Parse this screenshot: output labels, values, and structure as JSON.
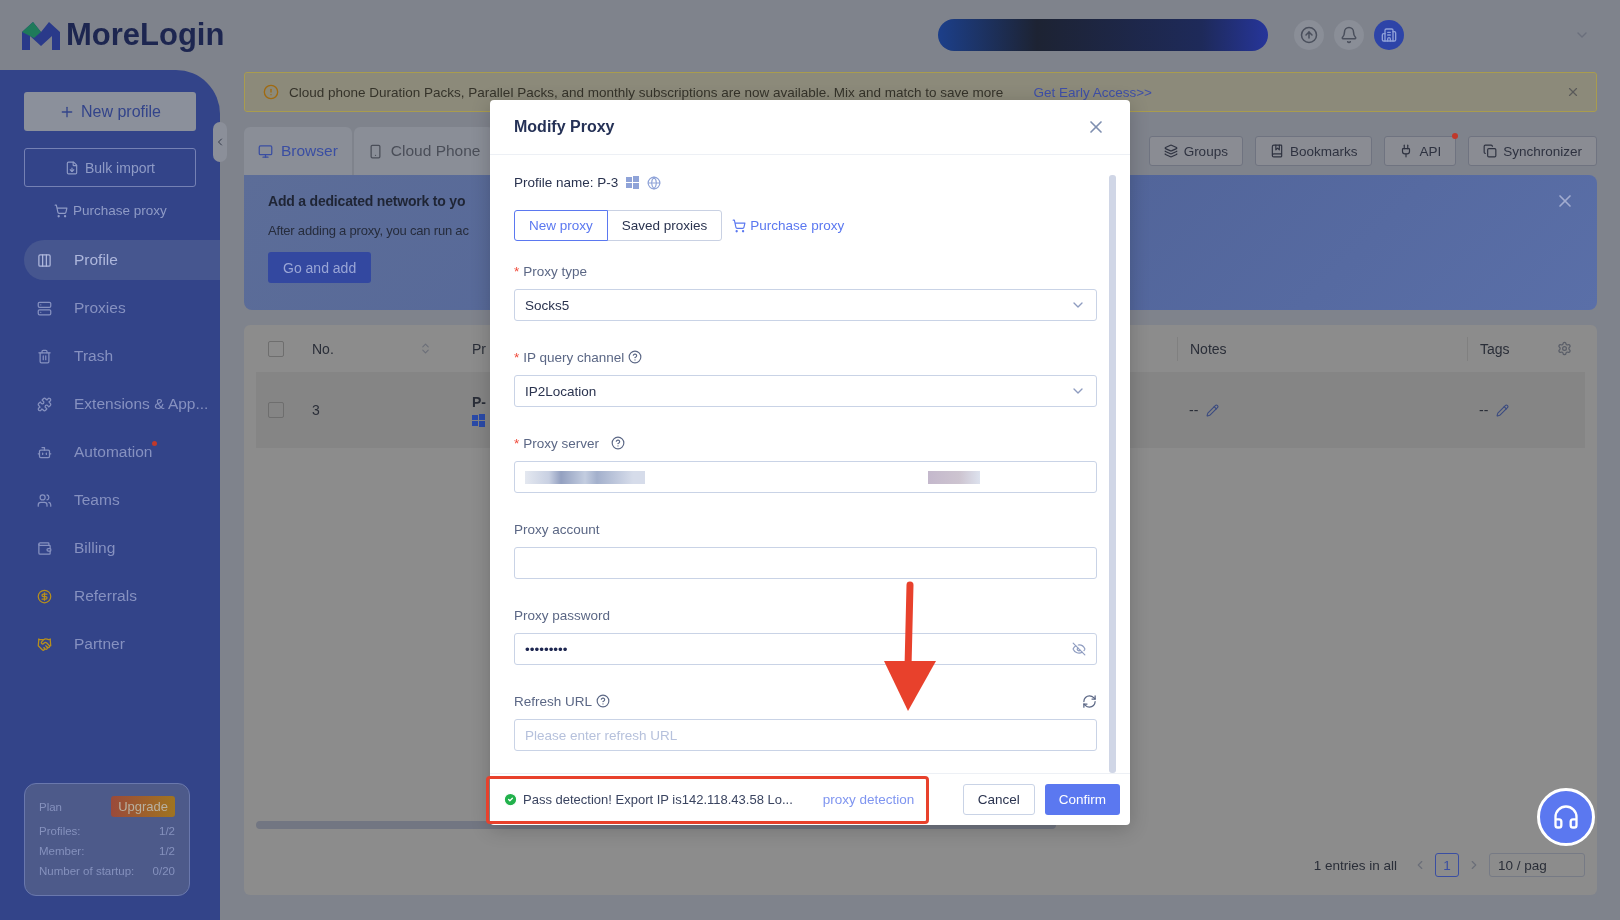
{
  "app": {
    "logo": "MoreLogin"
  },
  "sidebar": {
    "new_profile": "New profile",
    "bulk_import": "Bulk import",
    "purchase_proxy": "Purchase proxy",
    "nav": [
      {
        "label": "Profile",
        "selected": true,
        "dot": false
      },
      {
        "label": "Proxies",
        "selected": false,
        "dot": false
      },
      {
        "label": "Trash",
        "selected": false,
        "dot": false
      },
      {
        "label": "Extensions & App...",
        "selected": false,
        "dot": false
      },
      {
        "label": "Automation",
        "selected": false,
        "dot": true
      },
      {
        "label": "Teams",
        "selected": false,
        "dot": false
      },
      {
        "label": "Billing",
        "selected": false,
        "dot": false
      },
      {
        "label": "Referrals",
        "selected": false,
        "dot": false
      },
      {
        "label": "Partner",
        "selected": false,
        "dot": false
      }
    ],
    "plan": {
      "label": "Plan",
      "upgrade": "Upgrade",
      "stats": [
        {
          "label": "Profiles:",
          "value": "1/2"
        },
        {
          "label": "Member:",
          "value": "1/2"
        },
        {
          "label": "Number of startup:",
          "value": "0/20"
        }
      ]
    }
  },
  "notice": {
    "text": "Cloud phone Duration Packs, Parallel Packs, and monthly subscriptions are now available. Mix and match to save more",
    "link": "Get Early Access>>"
  },
  "tabs": [
    {
      "label": "Browser",
      "selected": true
    },
    {
      "label": "Cloud Phone",
      "selected": false
    }
  ],
  "toolbar": [
    {
      "label": "Groups",
      "dot": false
    },
    {
      "label": "Bookmarks",
      "dot": false
    },
    {
      "label": "API",
      "dot": true
    },
    {
      "label": "Synchronizer",
      "dot": false
    }
  ],
  "promo": {
    "title": "Add a dedicated network to yo",
    "text": "After adding a proxy, you can run ac",
    "button": "Go and add"
  },
  "table": {
    "all_checked": false,
    "columns": [
      "No.",
      "Pr",
      "Notes",
      "Tags"
    ],
    "rows": [
      {
        "checked": false,
        "no": "3",
        "name": "P-",
        "notes": "--",
        "tags": "--"
      }
    ],
    "total": "1 entries in all",
    "page": "1",
    "page_size": "10 / pag"
  },
  "modal": {
    "title": "Modify Proxy",
    "profile_label": "Profile name:",
    "profile_name": "P-3",
    "segments": [
      {
        "label": "New proxy",
        "selected": true
      },
      {
        "label": "Saved proxies",
        "selected": false
      }
    ],
    "purchase": "Purchase proxy",
    "fields": [
      {
        "kind": "select",
        "label": "Proxy type",
        "required_mark": "*",
        "help": false,
        "value": "Socks5"
      },
      {
        "kind": "select",
        "label": "IP query channel",
        "required_mark": "*",
        "help": true,
        "value": "IP2Location"
      },
      {
        "kind": "redacted",
        "label": "Proxy server",
        "required_mark": "*",
        "help": true
      },
      {
        "kind": "text",
        "label": "Proxy account",
        "help": false
      },
      {
        "kind": "password",
        "label": "Proxy password",
        "help": false,
        "value": "•••••••••"
      },
      {
        "kind": "refresh",
        "label": "Refresh URL",
        "help": true,
        "placeholder": "Please enter refresh URL"
      }
    ],
    "detection": {
      "passed": true,
      "status": "Pass detection! Export IP is142.118.43.58 Lo...",
      "link": "proxy detection"
    },
    "cancel": "Cancel",
    "confirm": "Confirm"
  }
}
